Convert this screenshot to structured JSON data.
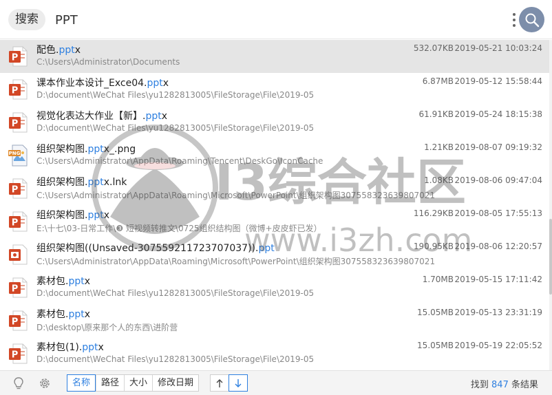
{
  "header": {
    "search_label": "搜索",
    "query": "PPT",
    "more_icon": "more-vertical-icon",
    "search_icon": "magnifier-icon"
  },
  "results": [
    {
      "name_pre": "配色.",
      "name_hl": "ppt",
      "name_post": "x",
      "path": "C:\\Users\\Administrator\\Documents",
      "size": "532.07KB",
      "date": "2019-05-21 10:03:24",
      "icon": "ppt-file-icon",
      "selected": true
    },
    {
      "name_pre": "课本作业本设计_Exce04.",
      "name_hl": "ppt",
      "name_post": "x",
      "path": "D:\\document\\WeChat Files\\yu1282813005\\FileStorage\\File\\2019-05",
      "size": "6.87MB",
      "date": "2019-05-12 15:58:44",
      "icon": "ppt-file-icon"
    },
    {
      "name_pre": "视觉化表达大作业【新】.",
      "name_hl": "ppt",
      "name_post": "x",
      "path": "D:\\document\\WeChat Files\\yu1282813005\\FileStorage\\File\\2019-05",
      "size": "61.91KB",
      "date": "2019-05-24 18:15:38",
      "icon": "ppt-file-icon"
    },
    {
      "name_pre": "组织架构图.",
      "name_hl": "ppt",
      "name_post": "x_.png",
      "path": "C:\\Users\\Administrator\\AppData\\Roaming\\Tencent\\DeskGo\\IconCache",
      "size": "1.21KB",
      "date": "2019-08-07 09:19:32",
      "icon": "png-file-icon"
    },
    {
      "name_pre": "组织架构图.",
      "name_hl": "ppt",
      "name_post": "x.lnk",
      "path": "C:\\Users\\Administrator\\AppData\\Roaming\\Microsoft\\PowerPoint\\组织架构图307558323639807021",
      "size": "1.08KB",
      "date": "2019-08-06 09:47:04",
      "icon": "ppt-file-icon"
    },
    {
      "name_pre": "组织架构图.",
      "name_hl": "ppt",
      "name_post": "x",
      "path": "E:\\十七\\03-日常工作\\❸ 短视频转推文\\0725组织结构图（微博+皮皮虾已发）",
      "size": "116.29KB",
      "date": "2019-08-05 17:55:13",
      "icon": "ppt-file-icon"
    },
    {
      "name_pre": "组织架构图((Unsaved-307559211723707037)).",
      "name_hl": "ppt",
      "name_post": "",
      "path": "C:\\Users\\Administrator\\AppData\\Roaming\\Microsoft\\PowerPoint\\组织架构图307558323639807021",
      "size": "190.95KB",
      "date": "2019-08-06 12:20:57",
      "icon": "ppt-legacy-file-icon"
    },
    {
      "name_pre": "素材包.",
      "name_hl": "ppt",
      "name_post": "x",
      "path": "D:\\document\\WeChat Files\\yu1282813005\\FileStorage\\File\\2019-05",
      "size": "1.70MB",
      "date": "2019-05-15 17:11:42",
      "icon": "ppt-file-icon"
    },
    {
      "name_pre": "素材包.",
      "name_hl": "ppt",
      "name_post": "x",
      "path": "D:\\desktop\\原来那个人的东西\\进阶营",
      "size": "15.05MB",
      "date": "2019-05-13 23:31:19",
      "icon": "ppt-file-icon"
    },
    {
      "name_pre": "素材包(1).",
      "name_hl": "ppt",
      "name_post": "x",
      "path": "D:\\document\\WeChat Files\\yu1282813005\\FileStorage\\File\\2019-05",
      "size": "15.05MB",
      "date": "2019-05-19 22:05:52",
      "icon": "ppt-file-icon"
    }
  ],
  "watermark": {
    "brand": "I3综合社区",
    "url": "www.i3zh.com"
  },
  "footer": {
    "sort_options": [
      "名称",
      "路径",
      "大小",
      "修改日期"
    ],
    "active_sort": "名称",
    "result_prefix": "找到 ",
    "result_count": "847",
    "result_suffix": " 条结果"
  },
  "colors": {
    "accent": "#2d7fe0",
    "ppt_red": "#d24726",
    "search_button": "#7d8eaa",
    "selected_row": "#e5e5e5"
  }
}
